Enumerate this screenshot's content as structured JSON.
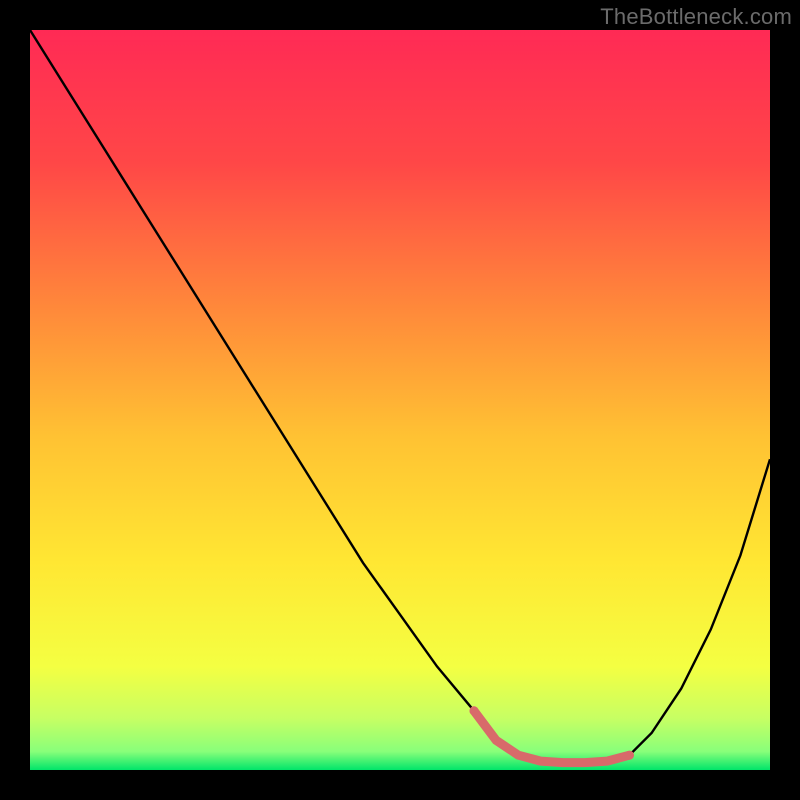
{
  "watermark": "TheBottleneck.com",
  "chart_data": {
    "type": "line",
    "title": "",
    "xlabel": "",
    "ylabel": "",
    "xlim": [
      0,
      100
    ],
    "ylim": [
      0,
      100
    ],
    "grid": false,
    "legend": false,
    "gradient_stops": [
      {
        "offset": 0.0,
        "color": "#ff2a55"
      },
      {
        "offset": 0.18,
        "color": "#ff4747"
      },
      {
        "offset": 0.38,
        "color": "#ff8a3a"
      },
      {
        "offset": 0.55,
        "color": "#ffc233"
      },
      {
        "offset": 0.72,
        "color": "#ffe733"
      },
      {
        "offset": 0.86,
        "color": "#f4ff42"
      },
      {
        "offset": 0.93,
        "color": "#c7ff63"
      },
      {
        "offset": 0.975,
        "color": "#89ff7a"
      },
      {
        "offset": 1.0,
        "color": "#00e56a"
      }
    ],
    "series": [
      {
        "name": "bottleneck-curve",
        "color": "#000000",
        "width": 2.4,
        "x": [
          0,
          5,
          10,
          15,
          20,
          25,
          30,
          35,
          40,
          45,
          50,
          55,
          60,
          63,
          66,
          69,
          72,
          75,
          78,
          81,
          84,
          88,
          92,
          96,
          100
        ],
        "y": [
          100,
          92,
          84,
          76,
          68,
          60,
          52,
          44,
          36,
          28,
          21,
          14,
          8,
          4,
          2,
          1.2,
          1.0,
          1.0,
          1.2,
          2,
          5,
          11,
          19,
          29,
          42
        ]
      }
    ],
    "highlight_segment": {
      "name": "flat-bottom-highlight",
      "color": "#d86a6a",
      "width": 9,
      "endpoint_radius": 4.5,
      "x": [
        60,
        63,
        66,
        69,
        72,
        75,
        78,
        81
      ],
      "y": [
        8,
        4,
        2,
        1.2,
        1,
        1,
        1.2,
        2
      ]
    }
  }
}
